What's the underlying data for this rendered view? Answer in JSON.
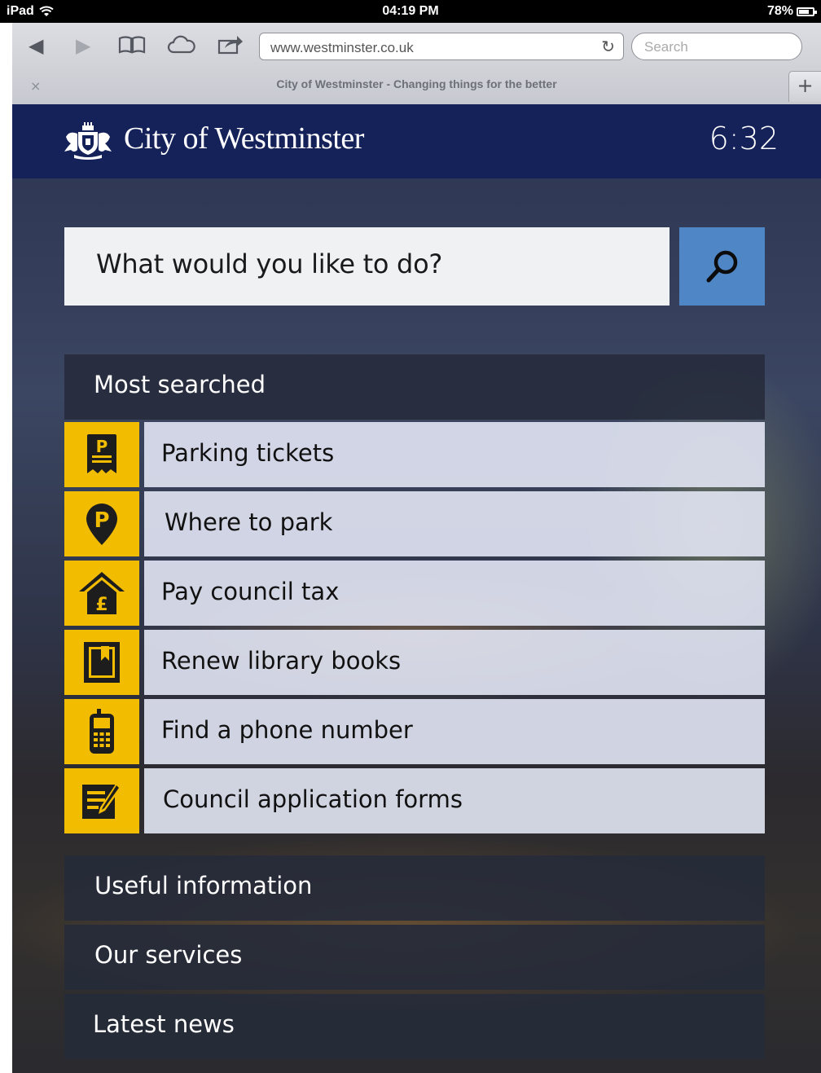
{
  "status_bar": {
    "device": "iPad",
    "time": "04:19 PM",
    "battery": "78%",
    "battery_level": 0.78
  },
  "browser": {
    "url": "www.westminster.co.uk",
    "search_placeholder": "Search",
    "tab_title": "City of Westminster - Changing things for the better",
    "tab_close": "×",
    "tab_add": "+"
  },
  "header": {
    "site_title": "City of Westminster",
    "clock": "6:32"
  },
  "search": {
    "prompt": "What would you like to do?"
  },
  "most_searched": {
    "heading": "Most searched",
    "items": [
      {
        "label": "Parking tickets",
        "icon": "parking-ticket-icon"
      },
      {
        "label": "Where to park",
        "icon": "parking-pin-icon"
      },
      {
        "label": "Pay council tax",
        "icon": "house-pound-icon"
      },
      {
        "label": "Renew library books",
        "icon": "book-icon"
      },
      {
        "label": "Find a phone number",
        "icon": "phone-icon"
      },
      {
        "label": "Council application forms",
        "icon": "form-icon"
      }
    ]
  },
  "sections": [
    {
      "label": "Useful information"
    },
    {
      "label": "Our services"
    },
    {
      "label": "Latest news"
    }
  ],
  "colors": {
    "header_bg": "#15225a",
    "accent_yellow": "#f2bc00",
    "search_button": "#4f86c6"
  }
}
